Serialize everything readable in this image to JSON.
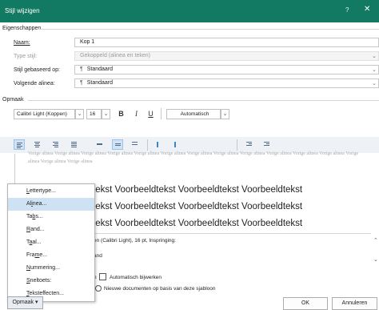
{
  "dialog": {
    "title": "Stijl wijzigen",
    "help_glyph": "?",
    "close_glyph": "✕"
  },
  "properties": {
    "section_label": "Eigenschappen",
    "name_label": "Naam:",
    "name_value": "Kop 1",
    "type_label": "Type stijl:",
    "type_value": "Gekoppeld (alinea en teken)",
    "based_on_label": "Stijl gebaseerd op:",
    "based_on_value": "Standaard",
    "next_label": "Volgende alinea:",
    "next_value": "Standaard",
    "para_mark": "¶"
  },
  "formatting": {
    "section_label": "Opmaak",
    "font": "Calibri Light (Koppen)",
    "size": "16",
    "bold": "B",
    "italic": "I",
    "underline": "U",
    "color": "Automatisch"
  },
  "preview": {
    "prev_paragraph": "Vorige alinea Vorige alinea Vorige alinea Vorige alinea Vorige alinea Vorige alinea Vorige alinea Vorige alinea Vorige alinea Vorige alinea Vorige alinea Vorige alinea Vorige alinea Vorige alinea Vorige alinea",
    "sample_line_1": "tekst Voorbeeldtekst Voorbeeldtekst Voorbeeldtekst",
    "sample_line_2": "tekst Voorbeeldtekst Voorbeeldtekst Voorbeeldtekst",
    "sample_line_3": "tekst Voorbeeldtekst Voorbeeldtekst Voorbeeldtekst"
  },
  "description": {
    "line1": "en (Calibri Light), 16 pt, Inspringing:",
    "line2": "and"
  },
  "options": {
    "auto_update_label": "Automatisch bijwerken",
    "radio_prefix": "n",
    "new_docs_label": "Nieuwe documenten op basis van deze sjabloon"
  },
  "menu": {
    "items": [
      "Lettertype...",
      "Alinea...",
      "Tabs...",
      "Rand...",
      "Taal...",
      "Frame...",
      "Nummering...",
      "Sneltoets:",
      "Teksteffecten..."
    ],
    "highlighted_index": 1
  },
  "buttons": {
    "format": "Opmaak",
    "format_caret": "▾",
    "ok": "OK",
    "cancel": "Annuleren"
  },
  "colors": {
    "titlebar": "#127a63",
    "highlight": "#cfe2f3"
  }
}
